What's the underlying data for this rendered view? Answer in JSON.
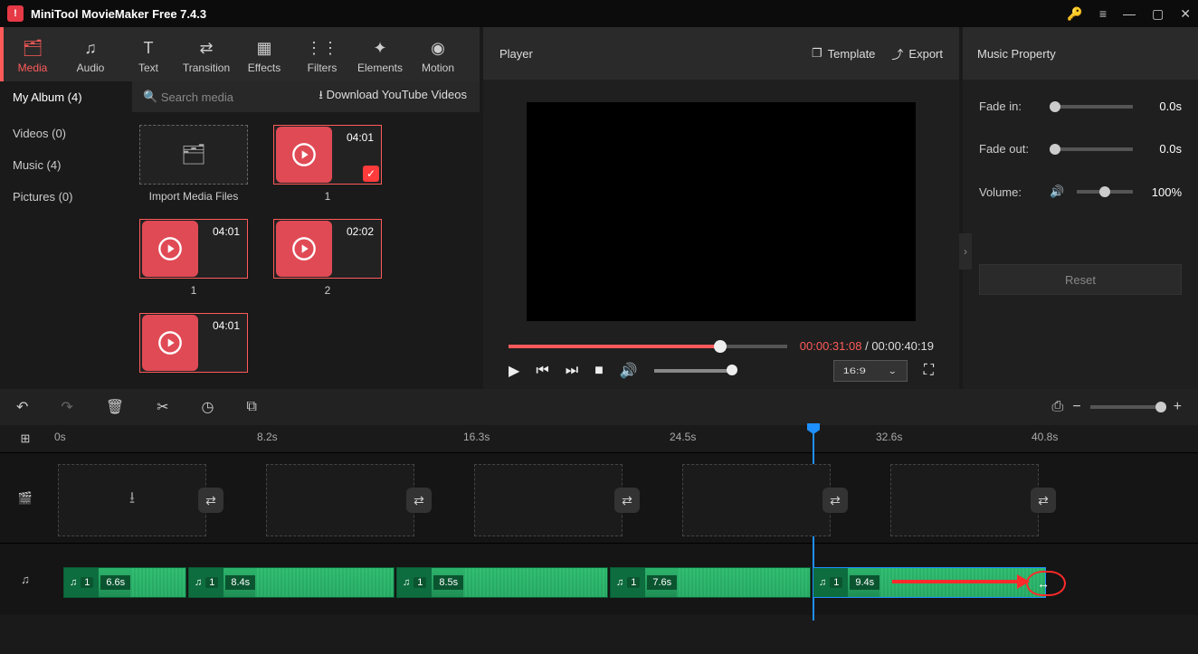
{
  "app": {
    "title": "MiniTool MovieMaker Free 7.4.3"
  },
  "toolbar": {
    "media": "Media",
    "audio": "Audio",
    "text": "Text",
    "transition": "Transition",
    "effects": "Effects",
    "filters": "Filters",
    "elements": "Elements",
    "motion": "Motion"
  },
  "sidebar": {
    "album": "My Album (4)",
    "videos": "Videos (0)",
    "music": "Music (4)",
    "pictures": "Pictures (0)"
  },
  "subhead": {
    "search_placeholder": "Search media",
    "download": "Download YouTube Videos"
  },
  "media_items": {
    "import": "Import Media Files",
    "i1_dur": "04:01",
    "i1_cap": "1",
    "i2_dur": "04:01",
    "i2_cap": "1",
    "i3_dur": "02:02",
    "i3_cap": "2",
    "i4_dur": "04:01"
  },
  "player": {
    "title": "Player",
    "template": "Template",
    "export": "Export",
    "current": "00:00:31:08",
    "sep": " / ",
    "total": "00:00:40:19",
    "ratio": "16:9"
  },
  "property": {
    "title": "Music Property",
    "fadein": "Fade in:",
    "fadein_v": "0.0s",
    "fadeout": "Fade out:",
    "fadeout_v": "0.0s",
    "volume": "Volume:",
    "volume_v": "100%",
    "reset": "Reset"
  },
  "ruler": {
    "t0": "0s",
    "t1": "8.2s",
    "t2": "16.3s",
    "t3": "24.5s",
    "t4": "32.6s",
    "t5": "40.8s"
  },
  "clips": {
    "c1": "6.6s",
    "c2": "8.4s",
    "c3": "8.5s",
    "c4": "7.6s",
    "c5": "9.4s",
    "num": "1"
  }
}
